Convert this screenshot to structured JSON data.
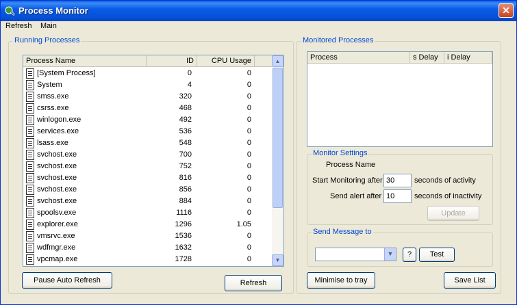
{
  "window": {
    "title": "Process Monitor",
    "close_glyph": "✕"
  },
  "menu": {
    "items": [
      "Refresh",
      "Main"
    ]
  },
  "running": {
    "group_label": "Running Processes",
    "columns": [
      "Process Name",
      "ID",
      "CPU Usage"
    ],
    "rows": [
      {
        "name": "[System Process]",
        "id": "0",
        "cpu": "0"
      },
      {
        "name": "System",
        "id": "4",
        "cpu": "0"
      },
      {
        "name": "smss.exe",
        "id": "320",
        "cpu": "0"
      },
      {
        "name": "csrss.exe",
        "id": "468",
        "cpu": "0"
      },
      {
        "name": "winlogon.exe",
        "id": "492",
        "cpu": "0"
      },
      {
        "name": "services.exe",
        "id": "536",
        "cpu": "0"
      },
      {
        "name": "lsass.exe",
        "id": "548",
        "cpu": "0"
      },
      {
        "name": "svchost.exe",
        "id": "700",
        "cpu": "0"
      },
      {
        "name": "svchost.exe",
        "id": "752",
        "cpu": "0"
      },
      {
        "name": "svchost.exe",
        "id": "816",
        "cpu": "0"
      },
      {
        "name": "svchost.exe",
        "id": "856",
        "cpu": "0"
      },
      {
        "name": "svchost.exe",
        "id": "884",
        "cpu": "0"
      },
      {
        "name": "spoolsv.exe",
        "id": "1116",
        "cpu": "0"
      },
      {
        "name": "explorer.exe",
        "id": "1296",
        "cpu": "1.05"
      },
      {
        "name": "vmsrvc.exe",
        "id": "1536",
        "cpu": "0"
      },
      {
        "name": "wdfmgr.exe",
        "id": "1632",
        "cpu": "0"
      },
      {
        "name": "vpcmap.exe",
        "id": "1728",
        "cpu": "0"
      }
    ],
    "pause_button": "Pause Auto Refresh",
    "refresh_button": "Refresh"
  },
  "monitored": {
    "group_label": "Monitored Processes",
    "columns": [
      "Process",
      "s Delay",
      "i Delay"
    ]
  },
  "settings": {
    "group_label": "Monitor Settings",
    "process_name_label": "Process Name",
    "start_label": "Start Monitoring after",
    "start_value": "30",
    "start_suffix": "seconds of activity",
    "alert_label": "Send alert after",
    "alert_value": "10",
    "alert_suffix": "seconds of inactivity",
    "update_button": "Update"
  },
  "message": {
    "group_label": "Send Message to",
    "selected": "",
    "help_button": "?",
    "test_button": "Test"
  },
  "footer": {
    "minimise_button": "Minimise to tray",
    "save_button": "Save List"
  },
  "icons": {
    "app": "process-monitor-icon",
    "document": "document-icon"
  },
  "colors": {
    "title_bar": "#0a5ce8",
    "group_label": "#0046d5",
    "window_bg": "#ece9d8"
  }
}
